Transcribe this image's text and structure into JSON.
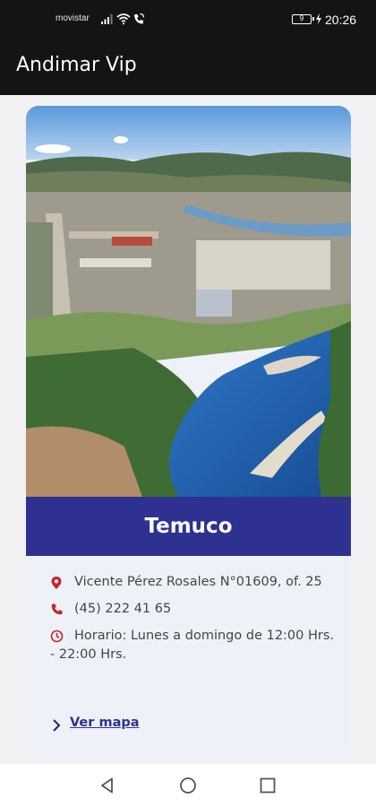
{
  "status_bar": {
    "carrier": "movistar",
    "battery": "9",
    "time": "20:26",
    "icons": [
      "signal-icon",
      "wifi-icon",
      "wifi-calling-icon",
      "battery-icon",
      "charging-icon"
    ]
  },
  "app_bar": {
    "title": "Andimar Vip"
  },
  "office": {
    "city": "Temuco",
    "address": "Vicente Pérez Rosales N°01609, of. 25",
    "phone": "(45) 222 41 65",
    "hours": "Horario: Lunes a domingo de 12:00 Hrs. - 22:00 Hrs.",
    "map_link": "Ver mapa"
  },
  "nav_bar": {
    "icons": [
      "back-icon",
      "home-icon",
      "recents-icon"
    ]
  },
  "colors": {
    "bar": "#141414",
    "banner": "#2e318f",
    "card": "#eef2f8",
    "icon_accent": "#d0202c",
    "link": "#2e318f"
  }
}
